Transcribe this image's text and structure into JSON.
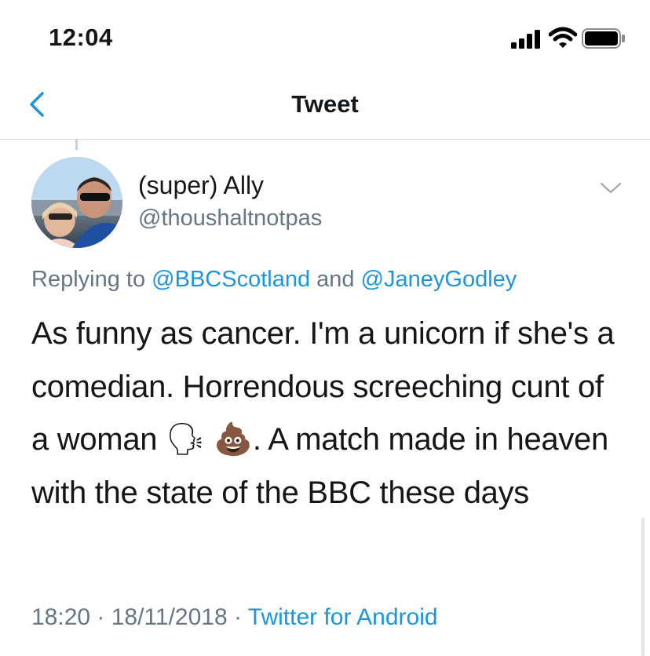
{
  "status_bar": {
    "time": "12:04",
    "icons": [
      "cellular-signal-icon",
      "wifi-icon",
      "battery-icon"
    ]
  },
  "nav": {
    "title": "Tweet",
    "back_icon": "chevron-left-icon"
  },
  "tweet": {
    "display_name": "(super) Ally",
    "handle": "@thoushaltnotpas",
    "more_icon": "chevron-down-icon",
    "replying_prefix": "Replying to ",
    "reply_to_1": "@BBCScotland",
    "reply_joiner": " and ",
    "reply_to_2": "@JaneyGodley",
    "text_1": "As funny as cancer. I'm a unicorn if she's a comedian. Horrendous screeching cunt of a woman ",
    "emoji_1": "🗣",
    "emoji_2": "💩",
    "text_2": ". A match made in heaven with the state of the BBC these days",
    "time": "18:20",
    "date": "18/11/2018",
    "separator": " · ",
    "source": "Twitter for Android"
  },
  "colors": {
    "accent": "#1b95e0",
    "secondary_text": "#657786",
    "primary_text": "#14171a",
    "divider": "#cfd4d9"
  }
}
